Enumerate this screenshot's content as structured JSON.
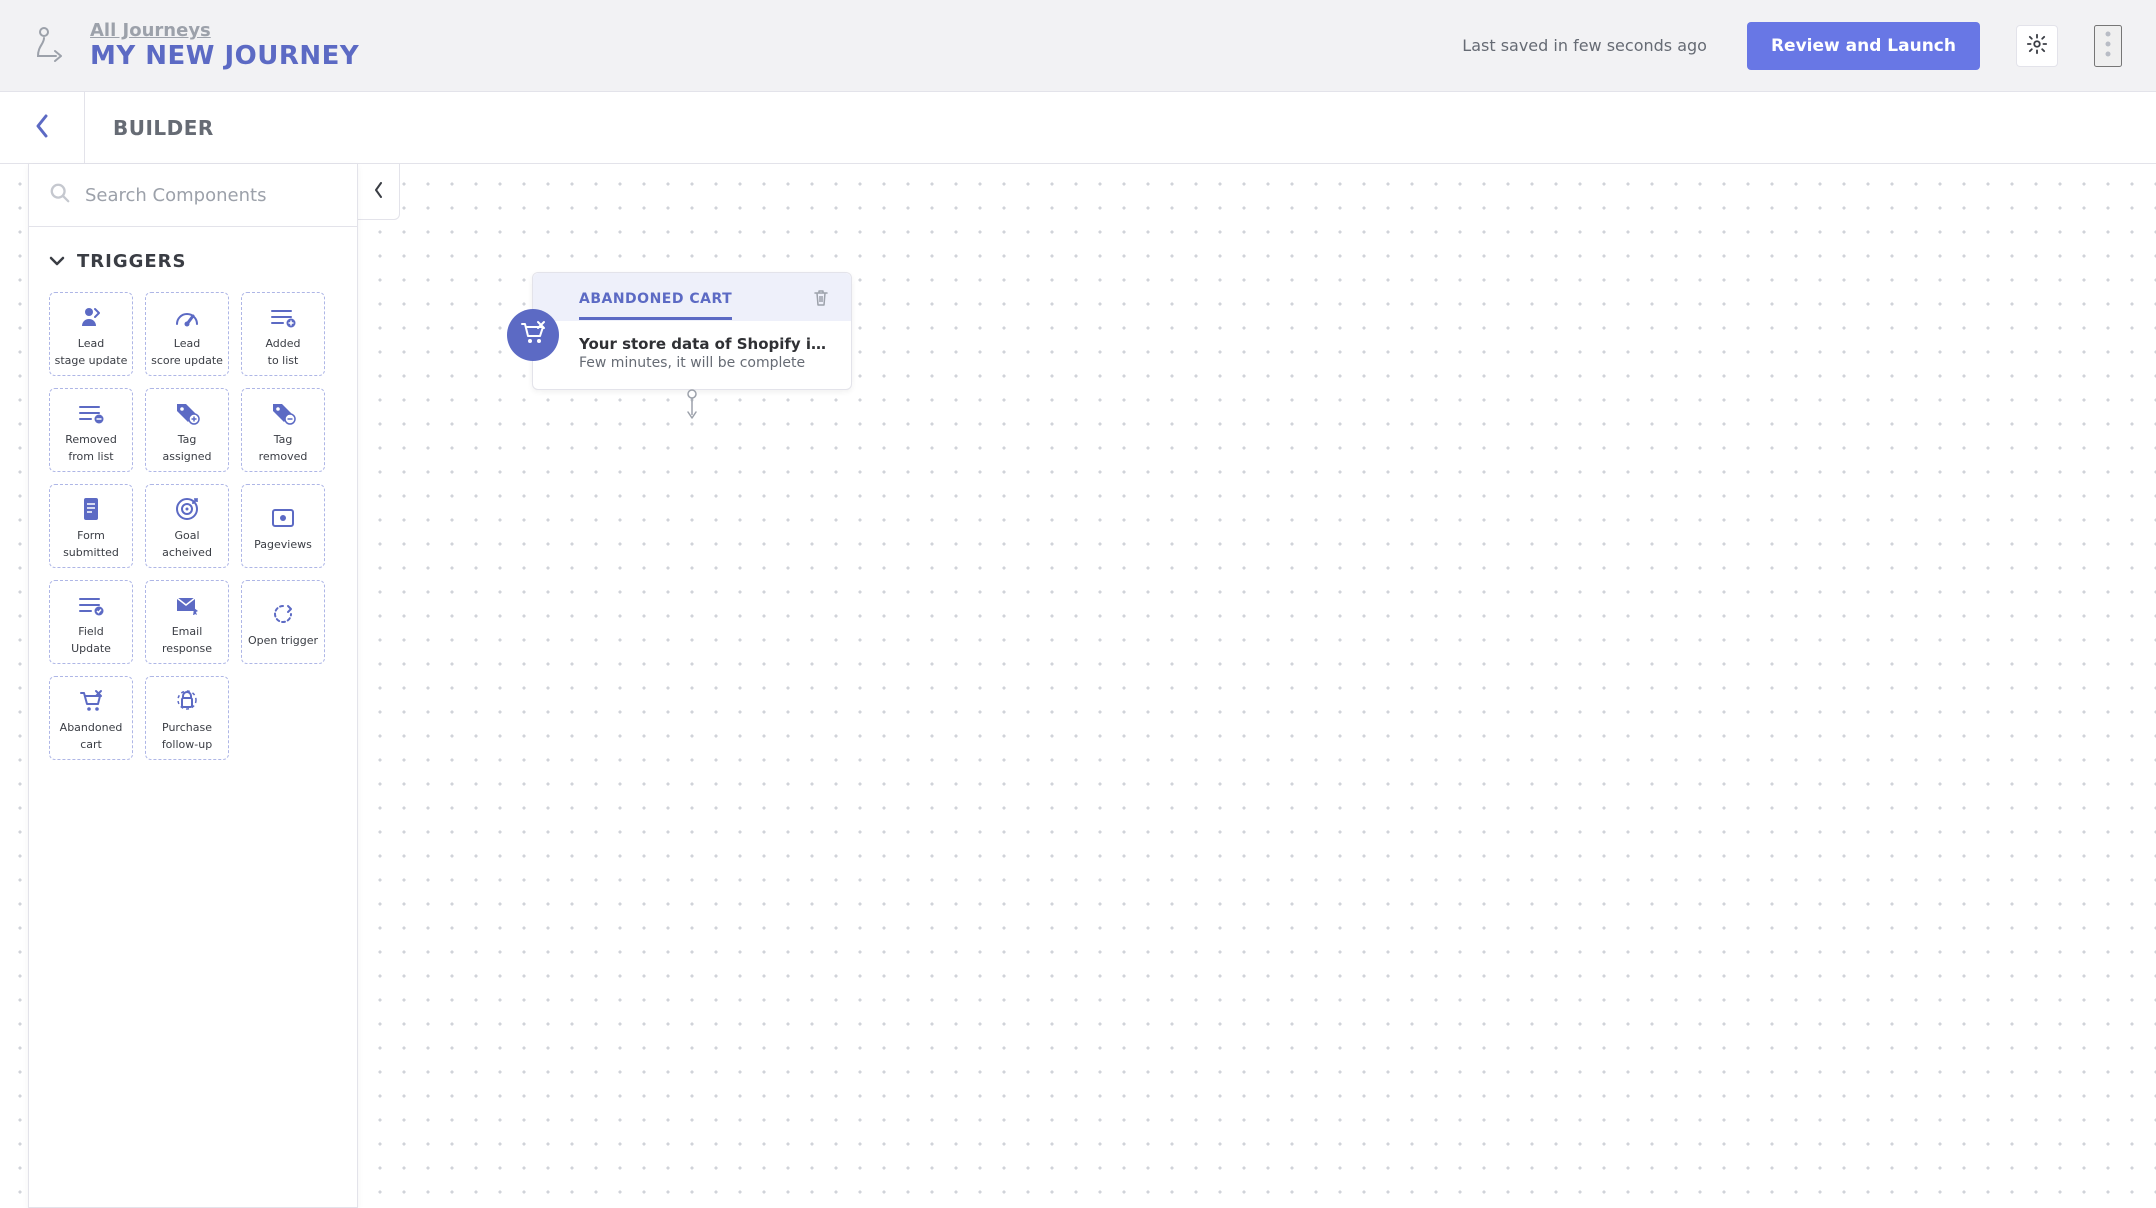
{
  "header": {
    "breadcrumb": "All Journeys",
    "page_title": "MY NEW JOURNEY",
    "last_saved": "Last saved in few seconds ago",
    "primary_button": "Review and Launch"
  },
  "subheader": {
    "section_title": "BUILDER"
  },
  "sidebar": {
    "search_placeholder": "Search Components",
    "section_label": "TRIGGERS",
    "triggers": [
      {
        "line1": "Lead",
        "line2": "stage update",
        "icon": "lead-stage"
      },
      {
        "line1": "Lead",
        "line2": "score update",
        "icon": "gauge"
      },
      {
        "line1": "Added",
        "line2": "to list",
        "icon": "list-add"
      },
      {
        "line1": "Removed",
        "line2": "from list",
        "icon": "list-remove"
      },
      {
        "line1": "Tag",
        "line2": "assigned",
        "icon": "tag-plus"
      },
      {
        "line1": "Tag",
        "line2": "removed",
        "icon": "tag-minus"
      },
      {
        "line1": "Form",
        "line2": "submitted",
        "icon": "form"
      },
      {
        "line1": "Goal",
        "line2": "acheived",
        "icon": "goal"
      },
      {
        "line1": "Pageviews",
        "line2": "",
        "icon": "page"
      },
      {
        "line1": "Field",
        "line2": "Update",
        "icon": "field"
      },
      {
        "line1": "Email",
        "line2": "response",
        "icon": "email"
      },
      {
        "line1": "Open trigger",
        "line2": "",
        "icon": "open"
      },
      {
        "line1": "Abandoned",
        "line2": "cart",
        "icon": "cart"
      },
      {
        "line1": "Purchase",
        "line2": "follow-up",
        "icon": "purchase"
      }
    ]
  },
  "canvas": {
    "card": {
      "tab_label": "ABANDONED CART",
      "msg_title": "Your store data of Shopify is being synce…",
      "msg_sub": "Few minutes, it will be complete"
    }
  }
}
